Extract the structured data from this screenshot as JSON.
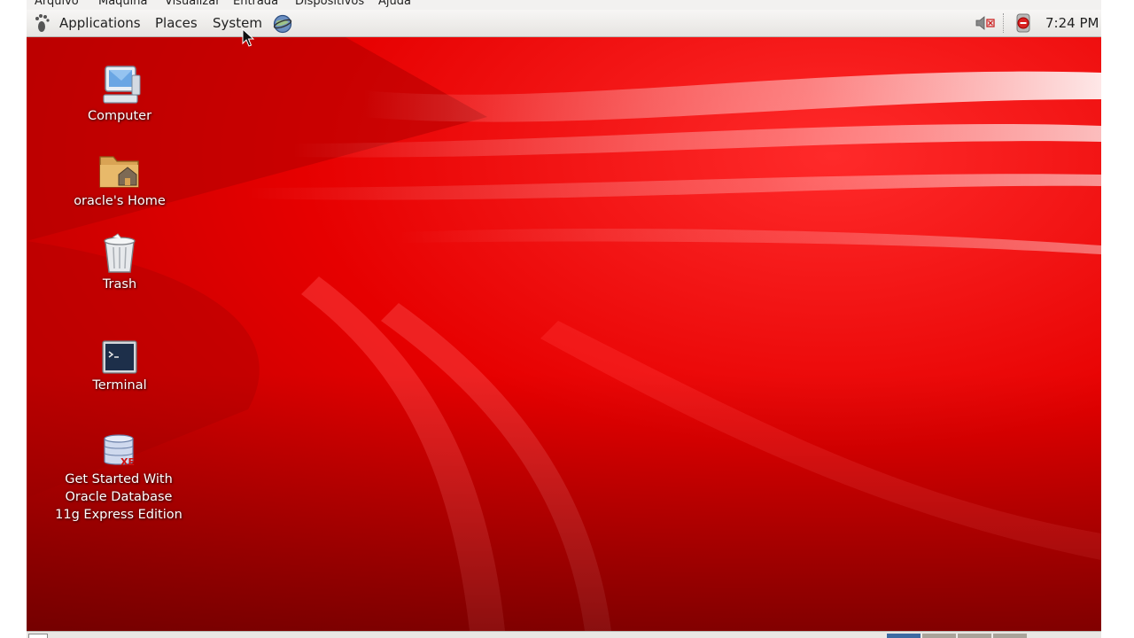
{
  "host_menu": [
    "Arquivo",
    "Máquina",
    "Visualizar",
    "Entrada",
    "Dispositivos",
    "Ajuda"
  ],
  "panel": {
    "logo_icon": "gnome-foot-icon",
    "menus": [
      "Applications",
      "Places",
      "System"
    ],
    "launcher_icon": "web-browser-icon",
    "tray_icons": [
      "volume-muted-icon",
      "update-notifier-icon"
    ],
    "clock": "7:24 PM"
  },
  "desktop": {
    "wallpaper_color": "#d60000",
    "icons": [
      {
        "label": "Computer",
        "icon": "computer-icon"
      },
      {
        "label": "oracle's Home",
        "icon": "home-folder-icon"
      },
      {
        "label": "Trash",
        "icon": "trash-icon"
      },
      {
        "label": "Terminal",
        "icon": "terminal-icon"
      },
      {
        "label_lines": [
          "Get Started With",
          "Oracle Database",
          "11g Express Edition"
        ],
        "icon": "database-icon"
      }
    ]
  },
  "workspaces": {
    "count": 4,
    "active": 1
  }
}
